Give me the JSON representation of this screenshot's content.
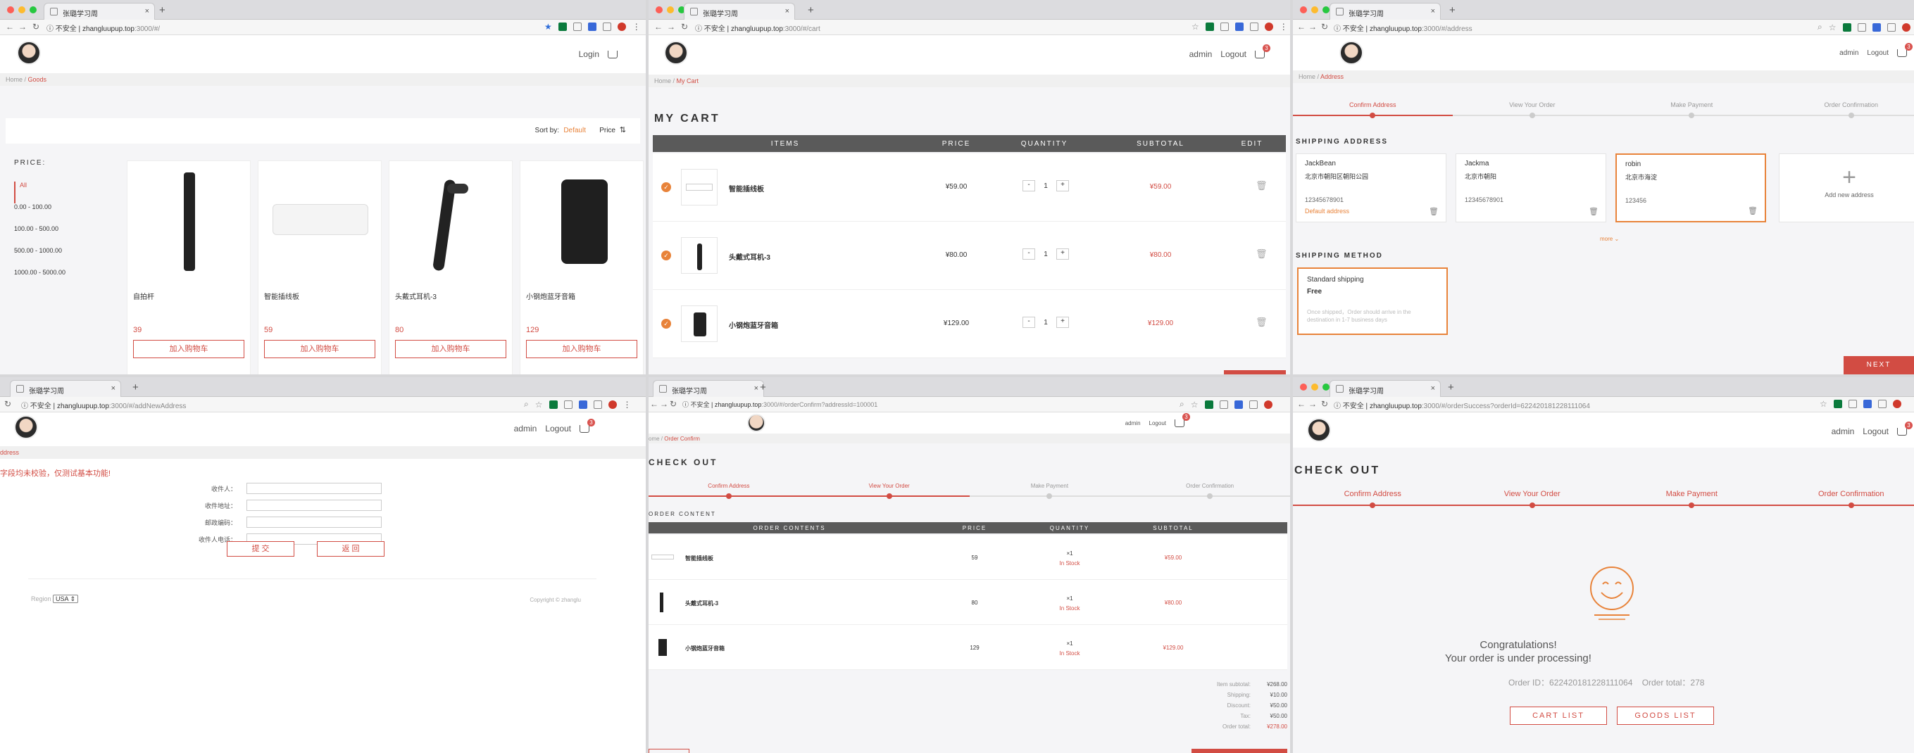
{
  "browser": {
    "tab_title": "张璐学习周",
    "insecure_label": "不安全"
  },
  "colors": {
    "accent": "#d24c43",
    "orange": "#e8833a",
    "dark_bar": "#5a5a5a"
  },
  "win1": {
    "url_host": "zhangluupup.top",
    "url_path": ":3000/#/",
    "login": "Login",
    "crumb_home": "Home",
    "crumb_cur": "Goods",
    "sort_by": "Sort by:",
    "sort_default": "Default",
    "sort_price": "Price",
    "price_title": "PRICE:",
    "price_ranges": [
      "All",
      "0.00 - 100.00",
      "100.00 - 500.00",
      "500.00 - 1000.00",
      "1000.00 - 5000.00"
    ],
    "products": [
      {
        "name": "自拍杆",
        "price": "39",
        "btn": "加入购物车"
      },
      {
        "name": "智能插线板",
        "price": "59",
        "btn": "加入购物车"
      },
      {
        "name": "头戴式耳机-3",
        "price": "80",
        "btn": "加入购物车"
      },
      {
        "name": "小钢炮蓝牙音箱",
        "price": "129",
        "btn": "加入购物车"
      }
    ]
  },
  "win2": {
    "url_host": "zhangluupup.top",
    "url_path": ":3000/#/cart",
    "user": "admin",
    "logout": "Logout",
    "cart_count": "3",
    "crumb_home": "Home",
    "crumb_cur": "My Cart",
    "title": "MY CART",
    "headers": [
      "ITEMS",
      "PRICE",
      "QUANTITY",
      "SUBTOTAL",
      "EDIT"
    ],
    "items": [
      {
        "name": "智能插线板",
        "price": "¥59.00",
        "qty": "1",
        "subtotal": "¥59.00"
      },
      {
        "name": "头戴式耳机-3",
        "price": "¥80.00",
        "qty": "1",
        "subtotal": "¥80.00"
      },
      {
        "name": "小钢炮蓝牙音箱",
        "price": "¥129.00",
        "qty": "1",
        "subtotal": "¥129.00"
      }
    ],
    "minus": "-",
    "plus": "+"
  },
  "win3": {
    "url_host": "zhangluupup.top",
    "url_path": ":3000/#/address",
    "user": "admin",
    "logout": "Logout",
    "cart_count": "3",
    "crumb_home": "Home",
    "crumb_cur": "Address",
    "steps": [
      "Confirm Address",
      "View Your Order",
      "Make Payment",
      "Order Confirmation"
    ],
    "shipping_address_title": "SHIPPING ADDRESS",
    "addresses": [
      {
        "name": "JackBean",
        "addr": "北京市朝阳区朝阳公园",
        "phone": "12345678901",
        "default": "Default address"
      },
      {
        "name": "Jackma",
        "addr": "北京市朝阳",
        "phone": "12345678901",
        "default": ""
      },
      {
        "name": "robin",
        "addr": "北京市海淀",
        "phone": "123456",
        "default": ""
      }
    ],
    "add_new": "Add new address",
    "more": "more",
    "shipping_method_title": "SHIPPING METHOD",
    "method_name": "Standard shipping",
    "method_price": "Free",
    "method_desc": "Once shipped，Order should arrive in the destination in 1-7 business days",
    "next": "NEXT"
  },
  "win4": {
    "url_host": "zhangluupup.top",
    "url_path": ":3000/#/addNewAddress",
    "user": "admin",
    "logout": "Logout",
    "cart_count": "3",
    "crumb": "ddress",
    "notice": "字段均未校验，仅测试基本功能!",
    "labels": [
      "收件人：",
      "收件地址：",
      "邮政编码：",
      "收件人电话："
    ],
    "submit": "提 交",
    "back": "返 回",
    "region_label": "Region",
    "region_value": "USA",
    "copyright": "Copyright ©  zhanglu"
  },
  "win5": {
    "url_host": "zhangluupup.top",
    "url_path": ":3000/#/orderConfirm?addressId=100001",
    "user": "admin",
    "logout": "Logout",
    "cart_count": "3",
    "crumb_home": "ome",
    "crumb_cur": "Order Confirm",
    "title": "CHECK OUT",
    "steps": [
      "Confirm Address",
      "View Your Order",
      "Make Payment",
      "Order Confirmation"
    ],
    "section": "ORDER CONTENT",
    "headers": [
      "ORDER CONTENTS",
      "PRICE",
      "QUANTITY",
      "SUBTOTAL"
    ],
    "items": [
      {
        "name": "智能插线板",
        "price": "59",
        "qty": "×1",
        "stock": "In Stock",
        "subtotal": "¥59.00"
      },
      {
        "name": "头戴式耳机-3",
        "price": "80",
        "qty": "×1",
        "stock": "In Stock",
        "subtotal": "¥80.00"
      },
      {
        "name": "小钢炮蓝牙音箱",
        "price": "129",
        "qty": "×1",
        "stock": "In Stock",
        "subtotal": "¥129.00"
      }
    ],
    "summary": [
      {
        "label": "Item subtotal:",
        "value": "¥268.00"
      },
      {
        "label": "Shipping:",
        "value": "¥10.00"
      },
      {
        "label": "Discount:",
        "value": "¥50.00"
      },
      {
        "label": "Tax:",
        "value": "¥50.00"
      },
      {
        "label": "Order total:",
        "value": "¥278.00"
      }
    ]
  },
  "win6": {
    "url_host": "zhangluupup.top",
    "url_path": ":3000/#/orderSuccess?orderId=622420181228111064",
    "user": "admin",
    "logout": "Logout",
    "cart_count": "3",
    "title": "CHECK OUT",
    "steps": [
      "Confirm Address",
      "View Your Order",
      "Make Payment",
      "Order Confirmation"
    ],
    "congrats": "Congratulations!",
    "processing": "Your order is under processing!",
    "order_id_label": "Order ID：",
    "order_id": "622420181228111064",
    "order_total_label": "Order total：",
    "order_total": "278",
    "cart_list": "CART LIST",
    "goods_list": "GOODS LIST"
  }
}
